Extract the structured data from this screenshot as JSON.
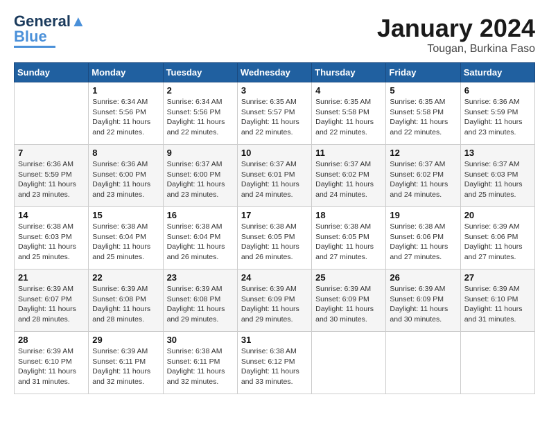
{
  "logo": {
    "text1": "General",
    "text2": "Blue"
  },
  "header": {
    "title": "January 2024",
    "subtitle": "Tougan, Burkina Faso"
  },
  "weekdays": [
    "Sunday",
    "Monday",
    "Tuesday",
    "Wednesday",
    "Thursday",
    "Friday",
    "Saturday"
  ],
  "weeks": [
    [
      {
        "day": "",
        "sunrise": "",
        "sunset": "",
        "daylight": ""
      },
      {
        "day": "1",
        "sunrise": "Sunrise: 6:34 AM",
        "sunset": "Sunset: 5:56 PM",
        "daylight": "Daylight: 11 hours and 22 minutes."
      },
      {
        "day": "2",
        "sunrise": "Sunrise: 6:34 AM",
        "sunset": "Sunset: 5:56 PM",
        "daylight": "Daylight: 11 hours and 22 minutes."
      },
      {
        "day": "3",
        "sunrise": "Sunrise: 6:35 AM",
        "sunset": "Sunset: 5:57 PM",
        "daylight": "Daylight: 11 hours and 22 minutes."
      },
      {
        "day": "4",
        "sunrise": "Sunrise: 6:35 AM",
        "sunset": "Sunset: 5:58 PM",
        "daylight": "Daylight: 11 hours and 22 minutes."
      },
      {
        "day": "5",
        "sunrise": "Sunrise: 6:35 AM",
        "sunset": "Sunset: 5:58 PM",
        "daylight": "Daylight: 11 hours and 22 minutes."
      },
      {
        "day": "6",
        "sunrise": "Sunrise: 6:36 AM",
        "sunset": "Sunset: 5:59 PM",
        "daylight": "Daylight: 11 hours and 23 minutes."
      }
    ],
    [
      {
        "day": "7",
        "sunrise": "Sunrise: 6:36 AM",
        "sunset": "Sunset: 5:59 PM",
        "daylight": "Daylight: 11 hours and 23 minutes."
      },
      {
        "day": "8",
        "sunrise": "Sunrise: 6:36 AM",
        "sunset": "Sunset: 6:00 PM",
        "daylight": "Daylight: 11 hours and 23 minutes."
      },
      {
        "day": "9",
        "sunrise": "Sunrise: 6:37 AM",
        "sunset": "Sunset: 6:00 PM",
        "daylight": "Daylight: 11 hours and 23 minutes."
      },
      {
        "day": "10",
        "sunrise": "Sunrise: 6:37 AM",
        "sunset": "Sunset: 6:01 PM",
        "daylight": "Daylight: 11 hours and 24 minutes."
      },
      {
        "day": "11",
        "sunrise": "Sunrise: 6:37 AM",
        "sunset": "Sunset: 6:02 PM",
        "daylight": "Daylight: 11 hours and 24 minutes."
      },
      {
        "day": "12",
        "sunrise": "Sunrise: 6:37 AM",
        "sunset": "Sunset: 6:02 PM",
        "daylight": "Daylight: 11 hours and 24 minutes."
      },
      {
        "day": "13",
        "sunrise": "Sunrise: 6:37 AM",
        "sunset": "Sunset: 6:03 PM",
        "daylight": "Daylight: 11 hours and 25 minutes."
      }
    ],
    [
      {
        "day": "14",
        "sunrise": "Sunrise: 6:38 AM",
        "sunset": "Sunset: 6:03 PM",
        "daylight": "Daylight: 11 hours and 25 minutes."
      },
      {
        "day": "15",
        "sunrise": "Sunrise: 6:38 AM",
        "sunset": "Sunset: 6:04 PM",
        "daylight": "Daylight: 11 hours and 25 minutes."
      },
      {
        "day": "16",
        "sunrise": "Sunrise: 6:38 AM",
        "sunset": "Sunset: 6:04 PM",
        "daylight": "Daylight: 11 hours and 26 minutes."
      },
      {
        "day": "17",
        "sunrise": "Sunrise: 6:38 AM",
        "sunset": "Sunset: 6:05 PM",
        "daylight": "Daylight: 11 hours and 26 minutes."
      },
      {
        "day": "18",
        "sunrise": "Sunrise: 6:38 AM",
        "sunset": "Sunset: 6:05 PM",
        "daylight": "Daylight: 11 hours and 27 minutes."
      },
      {
        "day": "19",
        "sunrise": "Sunrise: 6:38 AM",
        "sunset": "Sunset: 6:06 PM",
        "daylight": "Daylight: 11 hours and 27 minutes."
      },
      {
        "day": "20",
        "sunrise": "Sunrise: 6:39 AM",
        "sunset": "Sunset: 6:06 PM",
        "daylight": "Daylight: 11 hours and 27 minutes."
      }
    ],
    [
      {
        "day": "21",
        "sunrise": "Sunrise: 6:39 AM",
        "sunset": "Sunset: 6:07 PM",
        "daylight": "Daylight: 11 hours and 28 minutes."
      },
      {
        "day": "22",
        "sunrise": "Sunrise: 6:39 AM",
        "sunset": "Sunset: 6:08 PM",
        "daylight": "Daylight: 11 hours and 28 minutes."
      },
      {
        "day": "23",
        "sunrise": "Sunrise: 6:39 AM",
        "sunset": "Sunset: 6:08 PM",
        "daylight": "Daylight: 11 hours and 29 minutes."
      },
      {
        "day": "24",
        "sunrise": "Sunrise: 6:39 AM",
        "sunset": "Sunset: 6:09 PM",
        "daylight": "Daylight: 11 hours and 29 minutes."
      },
      {
        "day": "25",
        "sunrise": "Sunrise: 6:39 AM",
        "sunset": "Sunset: 6:09 PM",
        "daylight": "Daylight: 11 hours and 30 minutes."
      },
      {
        "day": "26",
        "sunrise": "Sunrise: 6:39 AM",
        "sunset": "Sunset: 6:09 PM",
        "daylight": "Daylight: 11 hours and 30 minutes."
      },
      {
        "day": "27",
        "sunrise": "Sunrise: 6:39 AM",
        "sunset": "Sunset: 6:10 PM",
        "daylight": "Daylight: 11 hours and 31 minutes."
      }
    ],
    [
      {
        "day": "28",
        "sunrise": "Sunrise: 6:39 AM",
        "sunset": "Sunset: 6:10 PM",
        "daylight": "Daylight: 11 hours and 31 minutes."
      },
      {
        "day": "29",
        "sunrise": "Sunrise: 6:39 AM",
        "sunset": "Sunset: 6:11 PM",
        "daylight": "Daylight: 11 hours and 32 minutes."
      },
      {
        "day": "30",
        "sunrise": "Sunrise: 6:38 AM",
        "sunset": "Sunset: 6:11 PM",
        "daylight": "Daylight: 11 hours and 32 minutes."
      },
      {
        "day": "31",
        "sunrise": "Sunrise: 6:38 AM",
        "sunset": "Sunset: 6:12 PM",
        "daylight": "Daylight: 11 hours and 33 minutes."
      },
      {
        "day": "",
        "sunrise": "",
        "sunset": "",
        "daylight": ""
      },
      {
        "day": "",
        "sunrise": "",
        "sunset": "",
        "daylight": ""
      },
      {
        "day": "",
        "sunrise": "",
        "sunset": "",
        "daylight": ""
      }
    ]
  ]
}
